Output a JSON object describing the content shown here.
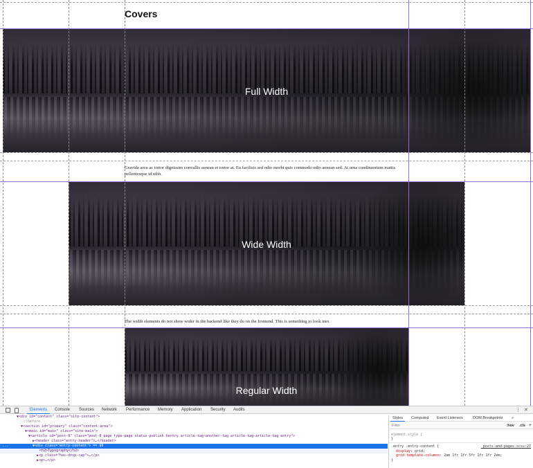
{
  "page": {
    "heading": "Covers",
    "covers": [
      {
        "caption": "Full Width"
      },
      {
        "caption": "Wide Width"
      },
      {
        "caption": "Regular Width"
      }
    ],
    "para1": "Gravida arcu ac tortor dignissim convallis aenean et tortor at. Eu facilisis sed odio morbi quis commodo odio aenean sed. At urna condimentum mattis pellentesque id nibh.",
    "para2": "The width elements do not show wider in the backend like they do on the frontend. This is something to look into."
  },
  "devtools": {
    "tabs": [
      "Elements",
      "Console",
      "Sources",
      "Network",
      "Performance",
      "Memory",
      "Application",
      "Security",
      "Audits"
    ],
    "active_tab": "Elements",
    "more_icon": "⋮",
    "close_icon": "✕",
    "dom_lines": [
      "▼<div id=\"content\" class=\"site-content\">",
      "::before",
      "▼<section id=\"primary\" class=\"content-area\">",
      "▼<main id=\"main\" class=\"site-main\">",
      "▼<article id=\"post-8\" class=\"post-8 page type-page status-publish hentry article-tag-another-tag article-tag-article-tag entry\">",
      "▶<header class=\"entry-header\">…</header>",
      "▼<div class=\"entry-content\"> == $0",
      "<h2>Typography</h2>",
      "▶<p class=\"has-drop-cap\">…</p>",
      "▶<p>…</p>"
    ],
    "dots": "...",
    "styles": {
      "tabs": [
        "Styles",
        "Computed",
        "Event Listeners",
        "DOM Breakpoints",
        "»"
      ],
      "filter_placeholder": "Filter",
      "hov": ":hov",
      "cls": ".cls",
      "plus": "+",
      "element_style": "element.style {",
      "close_brace": "}",
      "rule_selector": ".entry .entry-content {",
      "rule_source": "_posts-and-pages.scss:27",
      "display_prop": "display",
      "display_val": ": grid;",
      "gtc_prop": "grid-template-columns",
      "gtc_val": ": 2em 1fr 1fr 5fr 1fr 1fr 2em;"
    }
  }
}
